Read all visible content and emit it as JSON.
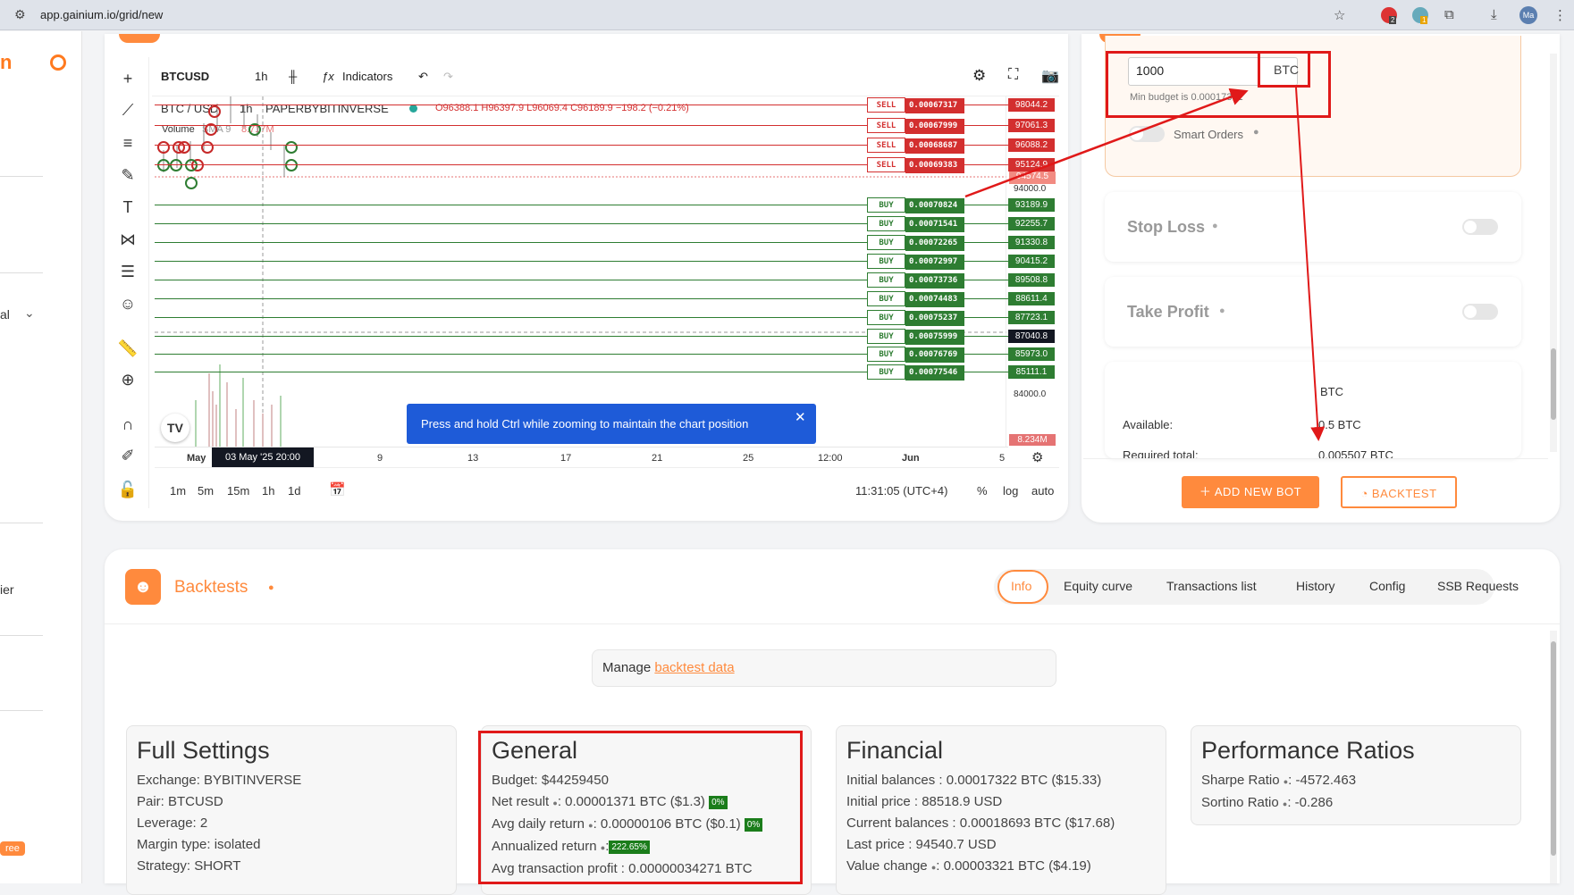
{
  "browser": {
    "url": "app.gainium.io/grid/new",
    "ext_badges": [
      "2",
      "1"
    ],
    "profile": "Ma"
  },
  "leftnav": {
    "labels": [
      "al",
      "ier"
    ],
    "free_badge": "ree"
  },
  "chart": {
    "symbol": "BTCUSD",
    "interval": "1h",
    "indicators_label": "Indicators",
    "legend": {
      "pair": "BTC / USD",
      "tf": "1h",
      "exchange": "PAPERBYBITINVERSE",
      "ohlc": "O96388.1 H96397.9 L96069.4 C96189.9 −198.2 (−0.21%)",
      "volume": "Volume",
      "sma": "SMA 9",
      "sma_val": "8.717M"
    },
    "sell_orders": [
      {
        "side": "SELL",
        "qty": "0.00067317",
        "price": "98044.2"
      },
      {
        "side": "SELL",
        "qty": "0.00067999",
        "price": "97061.3"
      },
      {
        "side": "SELL",
        "qty": "0.00068687",
        "price": "96088.2"
      },
      {
        "side": "SELL",
        "qty": "0.00069383",
        "price": "95124.9"
      }
    ],
    "buy_orders": [
      {
        "side": "BUY",
        "qty": "0.00070824",
        "price": "93189.9"
      },
      {
        "side": "BUY",
        "qty": "0.00071541",
        "price": "92255.7"
      },
      {
        "side": "BUY",
        "qty": "0.00072265",
        "price": "91330.8"
      },
      {
        "side": "BUY",
        "qty": "0.00072997",
        "price": "90415.2"
      },
      {
        "side": "BUY",
        "qty": "0.00073736",
        "price": "89508.8"
      },
      {
        "side": "BUY",
        "qty": "0.00074483",
        "price": "88611.4"
      },
      {
        "side": "BUY",
        "qty": "0.00075237",
        "price": "87723.1"
      },
      {
        "side": "BUY",
        "qty": "0.00075999",
        "price": "87040.8"
      },
      {
        "side": "BUY",
        "qty": "0.00076769",
        "price": "85973.0"
      },
      {
        "side": "BUY",
        "qty": "0.00077546",
        "price": "85111.1"
      }
    ],
    "price_axis": {
      "p94574": "94574.5",
      "p94000": "94000.0",
      "p84000": "84000.0",
      "vol": "8.234M"
    },
    "time_axis": [
      "May",
      "9",
      "13",
      "17",
      "21",
      "25",
      "12:00",
      "Jun",
      "5"
    ],
    "crosshair_date": "03 May '25  20:00",
    "tooltip": "Press and hold Ctrl while zooming to maintain the chart position",
    "bottom": {
      "timeframes": [
        "1m",
        "5m",
        "15m",
        "1h",
        "1d"
      ],
      "clock": "11:31:05 (UTC+4)",
      "pct": "%",
      "log": "log",
      "auto": "auto"
    }
  },
  "config": {
    "budget_value": "1000",
    "currency": "BTC",
    "min_budget": "Min budget is 0.00017391",
    "smart_orders": "Smart Orders",
    "stop_loss": "Stop Loss",
    "take_profit": "Take Profit",
    "balance": {
      "coin": "BTC",
      "available_label": "Available:",
      "available_value": "0.5 BTC",
      "required_label": "Required total:",
      "required_value": "0.005507 BTC"
    },
    "add_bot": "ADD NEW BOT",
    "backtest": "BACKTEST"
  },
  "backtests": {
    "title": "Backtests",
    "tabs": [
      "Info",
      "Equity curve",
      "Transactions list",
      "History",
      "Config",
      "SSB Requests"
    ],
    "manage_prefix": "Manage ",
    "manage_link": "backtest data",
    "full_settings": {
      "title": "Full Settings",
      "lines": [
        "Exchange: BYBITINVERSE",
        "Pair: BTCUSD",
        "Leverage: 2",
        "Margin type: isolated",
        "Strategy: SHORT"
      ]
    },
    "general": {
      "title": "General",
      "budget": "Budget: $44259450",
      "net": "Net result",
      "net_val": ": 0.00001371 BTC ($1.3)",
      "net_pct": "0%",
      "avg": "Avg daily return",
      "avg_val": ": 0.00000106 BTC ($0.1)",
      "avg_pct": "0%",
      "ann": "Annualized return",
      "ann_pct": "222.65%",
      "avg_tx": "Avg transaction profit : 0.00000034271 BTC"
    },
    "financial": {
      "title": "Financial",
      "lines": [
        "Initial balances : 0.00017322 BTC ($15.33)",
        "Initial price : 88518.9 USD",
        "Current balances : 0.00018693 BTC ($17.68)",
        "Last price : 94540.7 USD"
      ],
      "value_change": "Value change",
      "value_change_val": ": 0.00003321 BTC ($4.19)"
    },
    "ratios": {
      "title": "Performance Ratios",
      "sharpe": "Sharpe Ratio",
      "sharpe_val": ": -4572.463",
      "sortino": "Sortino Ratio",
      "sortino_val": ": -0.286"
    }
  },
  "colors": {
    "sell": "#d32f2f",
    "buy": "#2e7d32",
    "accent": "#ff8a3d",
    "annotation": "#e01919"
  }
}
